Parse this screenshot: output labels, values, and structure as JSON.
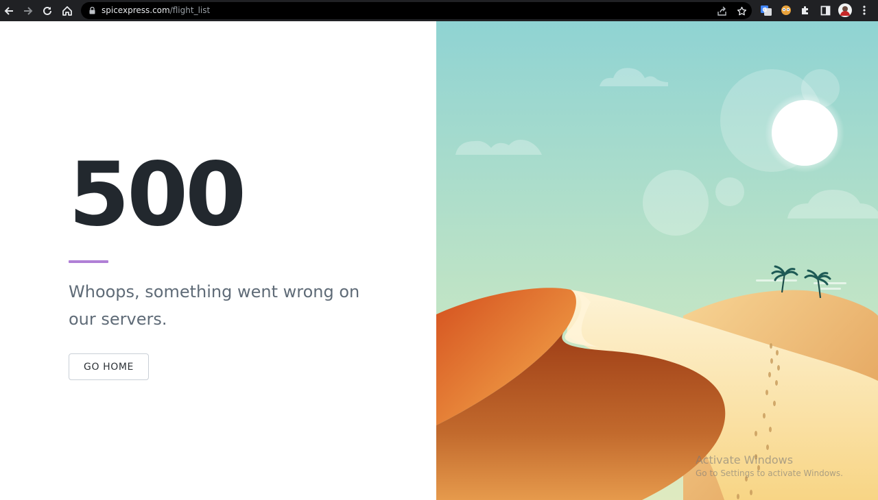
{
  "browser": {
    "url_host": "spicexpress.com",
    "url_path": "/flight_list",
    "icons": [
      "back-icon",
      "forward-icon",
      "reload-icon",
      "home-icon",
      "lock-icon",
      "share-icon",
      "bookmark-star-icon",
      "google-translate-icon",
      "extension-icon",
      "puzzle-icon",
      "side-panel-icon",
      "profile-avatar-icon",
      "menu-dots-icon"
    ]
  },
  "error": {
    "code": "500",
    "message": "Whoops, something went wrong on our servers.",
    "button_label": "GO HOME"
  },
  "colors": {
    "accent": "#b07fd6",
    "heading": "#22282e",
    "message": "#5f6b77"
  },
  "watermark": {
    "title": "Activate Windows",
    "subtitle": "Go to Settings to activate Windows."
  }
}
